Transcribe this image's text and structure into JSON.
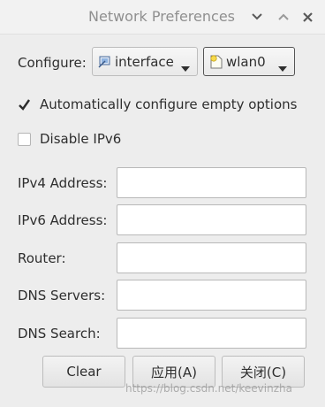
{
  "window": {
    "title": "Network Preferences",
    "controls": [
      "minimize",
      "maximize",
      "close"
    ]
  },
  "configure": {
    "label": "Configure:",
    "type_value": "interface",
    "device_value": "wlan0",
    "type_icon": "network-interface-icon",
    "device_icon": "device-icon"
  },
  "options": {
    "auto_configure": {
      "label": "Automatically configure empty options",
      "checked": true
    },
    "disable_ipv6": {
      "label": "Disable IPv6",
      "checked": false
    }
  },
  "fields": [
    {
      "label": "IPv4 Address:",
      "value": ""
    },
    {
      "label": "IPv6 Address:",
      "value": ""
    },
    {
      "label": "Router:",
      "value": ""
    },
    {
      "label": "DNS Servers:",
      "value": ""
    },
    {
      "label": "DNS Search:",
      "value": ""
    }
  ],
  "buttons": {
    "clear": "Clear",
    "apply": "应用(A)",
    "close": "关闭(C)"
  },
  "watermark": "https://blog.csdn.net/keevinzha"
}
